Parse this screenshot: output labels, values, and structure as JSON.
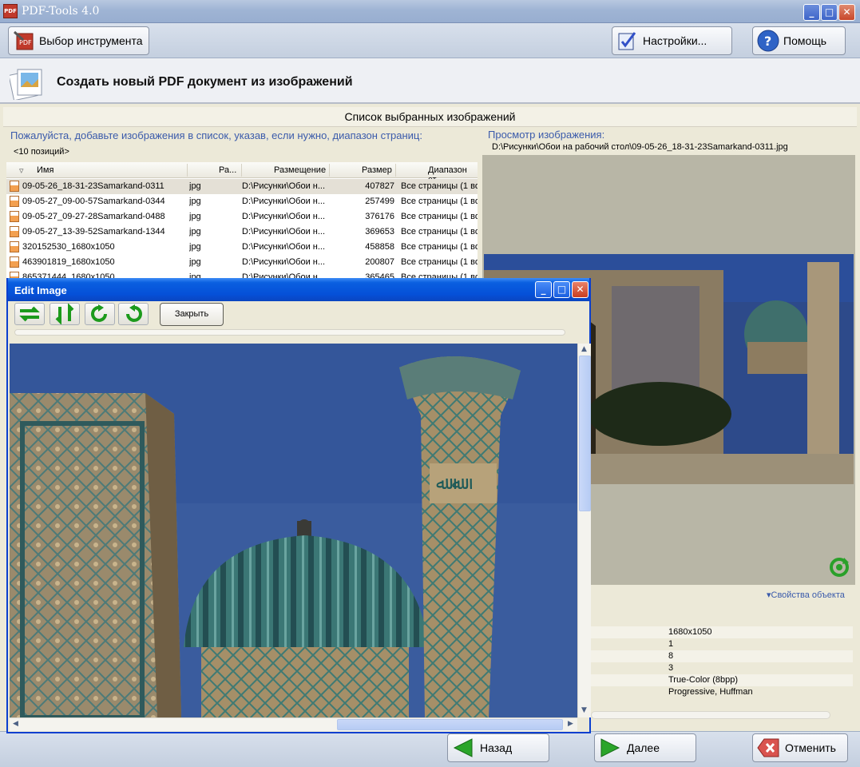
{
  "app": {
    "title": "PDF-Tools 4.0",
    "icon": "pdf-tools-icon"
  },
  "toolbar": {
    "select_tool": "Выбор инструмента",
    "settings": "Настройки...",
    "help": "Помощь"
  },
  "header": {
    "title": "Создать новый PDF документ из изображений"
  },
  "list": {
    "title": "Список выбранных изображений",
    "hint": "Пожалуйста, добавьте изображения в список, указав, если нужно, диапазон страниц:",
    "count": "<10 позиций>",
    "columns": [
      "Имя",
      "Ра...",
      "Размещение",
      "Размер",
      "Диапазон ст"
    ],
    "rows": [
      {
        "name": "09-05-26_18-31-23Samarkand-0311",
        "ext": "jpg",
        "location": "D:\\Рисунки\\Обои н...",
        "size": "407827",
        "range": "Все страницы (1 во"
      },
      {
        "name": "09-05-27_09-00-57Samarkand-0344",
        "ext": "jpg",
        "location": "D:\\Рисунки\\Обои н...",
        "size": "257499",
        "range": "Все страницы (1 во"
      },
      {
        "name": "09-05-27_09-27-28Samarkand-0488",
        "ext": "jpg",
        "location": "D:\\Рисунки\\Обои н...",
        "size": "376176",
        "range": "Все страницы (1 во"
      },
      {
        "name": "09-05-27_13-39-52Samarkand-1344",
        "ext": "jpg",
        "location": "D:\\Рисунки\\Обои н...",
        "size": "369653",
        "range": "Все страницы (1 во"
      },
      {
        "name": "320152530_1680x1050",
        "ext": "jpg",
        "location": "D:\\Рисунки\\Обои н...",
        "size": "458858",
        "range": "Все страницы (1 во"
      },
      {
        "name": "463901819_1680x1050",
        "ext": "jpg",
        "location": "D:\\Рисунки\\Обои н...",
        "size": "200807",
        "range": "Все страницы (1 во"
      },
      {
        "name": "865371444_1680x1050",
        "ext": "jpg",
        "location": "D:\\Рисунки\\Обои н...",
        "size": "365465",
        "range": "Все страницы (1 во"
      }
    ]
  },
  "preview": {
    "label": "Просмотр изображения:",
    "path": "D:\\Рисунки\\Обои на рабочий стол\\09-05-26_18-31-23Samarkand-0311.jpg",
    "props_link": "▾Свойства объекта",
    "props": [
      "1680x1050",
      "1",
      "8",
      "3",
      "True-Color (8bpp)",
      "Progressive, Huffman"
    ]
  },
  "dialog": {
    "title": "Edit Image",
    "close_button": "Закрыть",
    "tools": [
      "flip-horizontal-icon",
      "flip-vertical-icon",
      "rotate-right-icon",
      "rotate-left-icon"
    ]
  },
  "nav": {
    "back": "Назад",
    "next": "Далее",
    "cancel": "Отменить"
  },
  "colors": {
    "titlebar": "#9fb4d4",
    "dialog_title": "#0550d8",
    "link": "#3b5bab"
  }
}
